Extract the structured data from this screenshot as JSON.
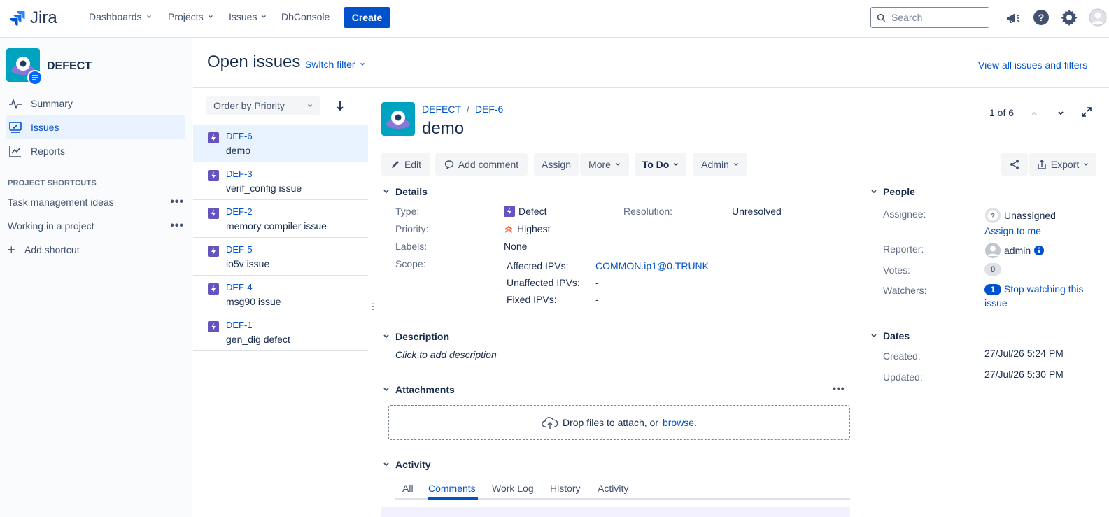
{
  "nav": {
    "logo_text": "Jira",
    "items": [
      "Dashboards",
      "Projects",
      "Issues",
      "DbConsole"
    ],
    "create_label": "Create",
    "search_placeholder": "Search"
  },
  "sidebar": {
    "project_name": "DEFECT",
    "items": [
      "Summary",
      "Issues",
      "Reports"
    ],
    "shortcuts_heading": "PROJECT SHORTCUTS",
    "shortcuts": [
      "Task management ideas",
      "Working in a project"
    ],
    "add_shortcut": "Add shortcut"
  },
  "main": {
    "title": "Open issues",
    "switch_filter": "Switch filter",
    "view_all": "View all issues and filters",
    "order_by": "Order by Priority"
  },
  "issues": [
    {
      "key": "DEF-6",
      "summary": "demo"
    },
    {
      "key": "DEF-3",
      "summary": "verif_config issue"
    },
    {
      "key": "DEF-2",
      "summary": "memory compiler issue"
    },
    {
      "key": "DEF-5",
      "summary": "io5v issue"
    },
    {
      "key": "DEF-4",
      "summary": "msg90 issue"
    },
    {
      "key": "DEF-1",
      "summary": "gen_dig defect"
    }
  ],
  "detail": {
    "breadcrumb_project": "DEFECT",
    "breadcrumb_sep": "/",
    "breadcrumb_key": "DEF-6",
    "title": "demo",
    "pager": "1 of 6",
    "buttons": {
      "edit": "Edit",
      "comment": "Add comment",
      "assign": "Assign",
      "more": "More",
      "status": "To Do",
      "admin": "Admin",
      "export": "Export"
    },
    "details_title": "Details",
    "fields": {
      "type_label": "Type:",
      "type_value": "Defect",
      "priority_label": "Priority:",
      "priority_value": "Highest",
      "labels_label": "Labels:",
      "labels_value": "None",
      "scope_label": "Scope:",
      "resolution_label": "Resolution:",
      "resolution_value": "Unresolved",
      "affected_label": "Affected IPVs:",
      "affected_value": "COMMON.ip1@0.TRUNK",
      "unaffected_label": "Unaffected IPVs:",
      "unaffected_value": "-",
      "fixed_label": "Fixed IPVs:",
      "fixed_value": "-"
    },
    "description_title": "Description",
    "description_placeholder": "Click to add description",
    "attachments_title": "Attachments",
    "drop_text": "Drop files to attach, or",
    "browse": "browse.",
    "activity_title": "Activity",
    "tabs": [
      "All",
      "Comments",
      "Work Log",
      "History",
      "Activity"
    ],
    "active_tab": "Comments"
  },
  "people": {
    "title": "People",
    "assignee_label": "Assignee:",
    "assignee_value": "Unassigned",
    "assign_to_me": "Assign to me",
    "reporter_label": "Reporter:",
    "reporter_value": "admin",
    "votes_label": "Votes:",
    "votes_value": "0",
    "watchers_label": "Watchers:",
    "watchers_count": "1",
    "watch_text_1": "Stop watching this",
    "watch_text_2": "issue"
  },
  "dates": {
    "title": "Dates",
    "created_label": "Created:",
    "created_value": "27/Jul/26 5:24 PM",
    "updated_label": "Updated:",
    "updated_value": "27/Jul/26 5:30 PM"
  },
  "colors": {
    "accent": "#0052cc",
    "defect_icon": "#6554c0",
    "priority_highest": "#ff5630"
  }
}
